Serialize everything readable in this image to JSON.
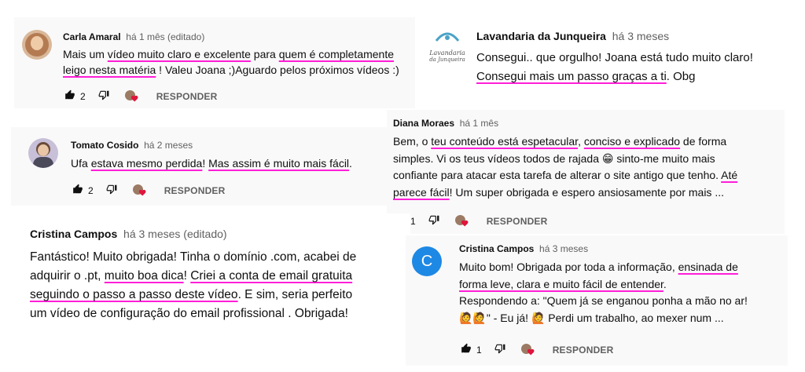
{
  "reply_label": "RESPONDER",
  "colors": {
    "highlight": "#ff1ed8",
    "avatar_c": "#1e88e5",
    "heart": "#e0143c"
  },
  "c1": {
    "author": "Carla Amaral",
    "meta": "há 1 mês (editado)",
    "l1": {
      "a": "Mais um ",
      "h1": "vídeo muito claro e excelente",
      "b": " para ",
      "h2": "quem é completamente"
    },
    "l2": {
      "h1": "leigo nesta matéria",
      "a": " ! Valeu Joana ;)Aguardo pelos próximos vídeos :)"
    },
    "likes": "2"
  },
  "c2": {
    "author": "Lavandaria da Junqueira",
    "meta": "há 3 meses",
    "logo_l1": "Lavandaria",
    "logo_l2": "da Junqueira",
    "l1": "Consegui.. que orgulho! Joana está tudo muito claro!",
    "l2": {
      "h1": "Consegui mais um passo graças a ti",
      "a": ". Obg"
    }
  },
  "c3": {
    "author": "Tomato Cosido",
    "meta": "há 2 meses",
    "l1": {
      "a": "Ufa ",
      "h1": "estava mesmo perdida",
      "b": "! ",
      "h2": "Mas assim é muito mais fácil",
      "c": "."
    },
    "likes": "2"
  },
  "c4": {
    "author": "Diana Moraes",
    "meta": "há 1 mês",
    "l1": {
      "a": "Bem, o ",
      "h1": "teu conteúdo está espetacular",
      "b": ", ",
      "h2": "conciso e explicado",
      "c": " de forma"
    },
    "l2": "simples. Vi os teus vídeos todos de rajada 😁 sinto-me muito mais",
    "l3": {
      "a": "confiante para atacar esta tarefa de alterar o site antigo que tenho. ",
      "h1": "Até"
    },
    "l4": {
      "h1": "parece fácil",
      "a": "! Um super obrigada e espero ansiosamente por mais ..."
    },
    "likes": "1"
  },
  "c5": {
    "author": "Cristina Campos",
    "meta": "há 3 meses (editado)",
    "l1": "Fantástico! Muito obrigada! Tinha o domínio .com, acabei de",
    "l2": {
      "a": "adquirir o .pt, ",
      "h1": "muito boa dica",
      "b": "!  ",
      "h2": "Criei a conta de email gratuita"
    },
    "l3": {
      "h1": "seguindo o passo a passo deste vídeo",
      "a": ". E sim, seria perfeito"
    },
    "l4": "um vídeo de configuração do email profissional . Obrigada!"
  },
  "c6": {
    "author": "Cristina Campos",
    "meta": "há 3 meses",
    "avatar_letter": "C",
    "l1": {
      "a": "Muito bom! Obrigada por toda a informação, ",
      "h1": "ensinada de"
    },
    "l2": {
      "h1": "forma leve, clara e muito fácil de entender",
      "a": "."
    },
    "l3": "Respondendo a: \"Quem já se enganou ponha a mão no ar!",
    "l4": "🙋🙋\" - Eu já! 🙋  Perdi um trabalho, ao mexer num ...",
    "likes": "1"
  }
}
